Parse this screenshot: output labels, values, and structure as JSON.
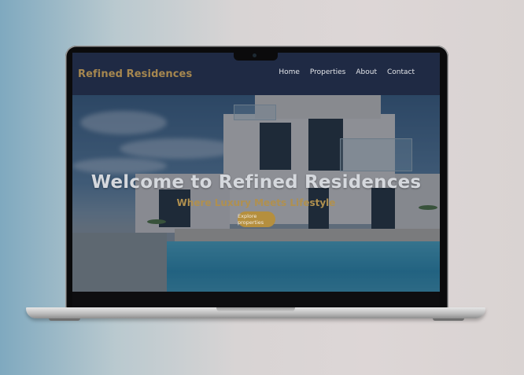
{
  "site": {
    "brand": "Refined Residences",
    "nav": [
      {
        "label": "Home"
      },
      {
        "label": "Properties"
      },
      {
        "label": "About"
      },
      {
        "label": "Contact"
      }
    ]
  },
  "hero": {
    "title": "Welcome to Refined Residences",
    "subtitle": "Where Luxury Meets Lifestyle",
    "cta_label": "Explore properties"
  },
  "colors": {
    "header_bg": "#1f2a44",
    "brand_gold": "#a6874f",
    "cta_gold": "#b58f3e"
  }
}
